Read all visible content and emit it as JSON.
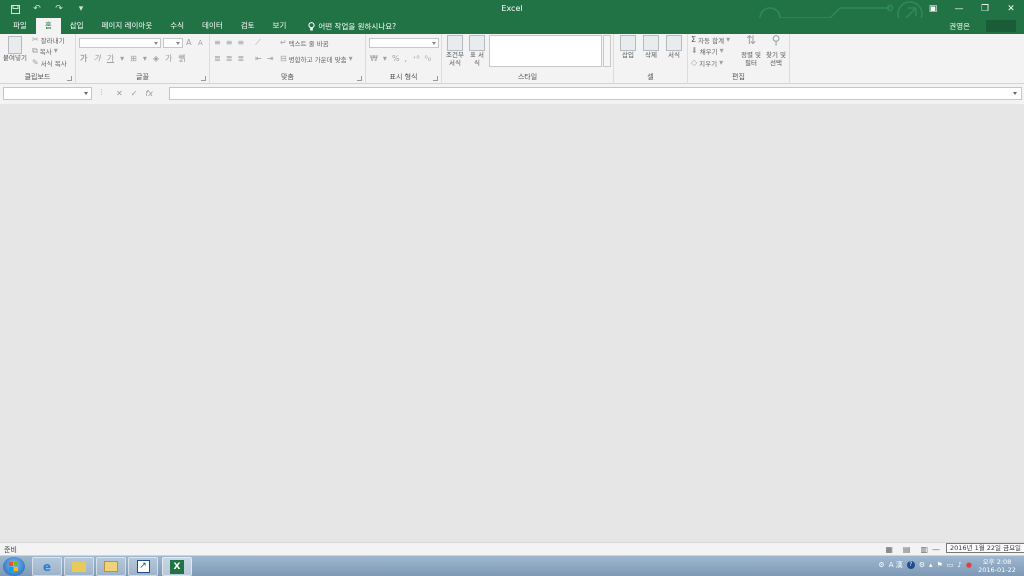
{
  "window": {
    "title": "Excel",
    "user": "권영은"
  },
  "tabs": [
    {
      "label": "파일"
    },
    {
      "label": "홈"
    },
    {
      "label": "삽입"
    },
    {
      "label": "페이지 레이아웃"
    },
    {
      "label": "수식"
    },
    {
      "label": "데이터"
    },
    {
      "label": "검토"
    },
    {
      "label": "보기"
    }
  ],
  "tell_me": "어떤 작업을 원하시나요?",
  "ribbon": {
    "clipboard": {
      "label": "클립보드",
      "paste": "붙여넣기",
      "cut": "잘라내기",
      "copy": "복사",
      "format_painter": "서식 복사"
    },
    "font": {
      "label": "글꼴",
      "bold": "가",
      "italic": "가",
      "underline": "가"
    },
    "alignment": {
      "label": "맞춤",
      "wrap_text": "텍스트 줄 바꿈",
      "merge_center": "병합하고 가운데 맞춤"
    },
    "number": {
      "label": "표시 형식",
      "percent": "%"
    },
    "styles": {
      "label": "스타일",
      "conditional": "조건부 서식",
      "table": "표 서식"
    },
    "cells": {
      "label": "셀",
      "insert": "삽입",
      "delete": "삭제",
      "format": "서식"
    },
    "editing": {
      "label": "편집",
      "autosum": "자동 합계",
      "fill": "채우기",
      "clear": "지우기",
      "sort": "정렬 및 필터",
      "find": "찾기 및 선택"
    }
  },
  "formula_bar": {
    "cancel": "✕",
    "enter": "✓",
    "fx": "fx"
  },
  "status": {
    "ready": "준비",
    "tooltip": "2016년 1월 22일 금요일"
  },
  "clock": {
    "time": "오후 2:08",
    "date": "2016-01-22"
  },
  "tray": {
    "ime": "A 漢"
  },
  "colors": {
    "accent": "#217346"
  }
}
